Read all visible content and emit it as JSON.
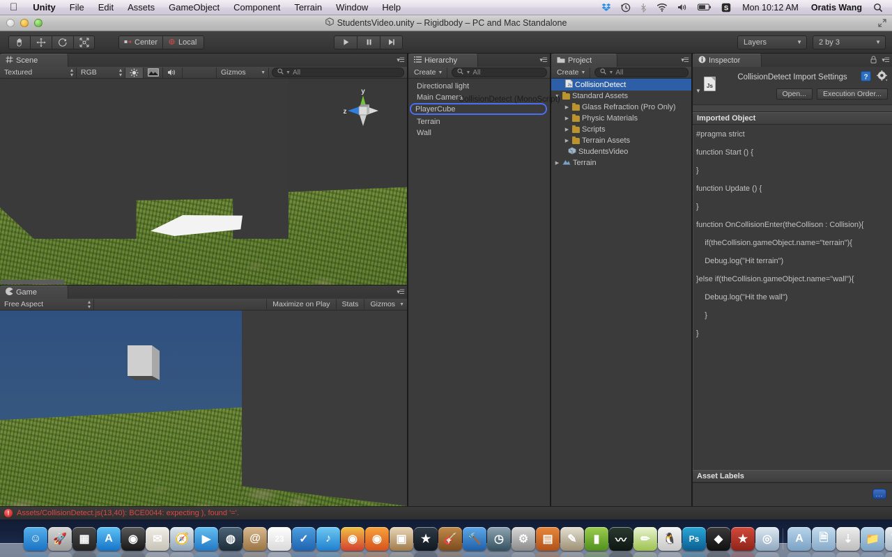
{
  "macbar": {
    "apple": "apple-logo",
    "menus": [
      "Unity",
      "File",
      "Edit",
      "Assets",
      "GameObject",
      "Component",
      "Terrain",
      "Window",
      "Help"
    ],
    "status_icons": [
      "dropbox-icon",
      "timemachine-icon",
      "bluetooth-icon",
      "wifi-icon",
      "volume-icon",
      "battery-icon",
      "snagit-icon"
    ],
    "clock": "Mon 10:12 AM",
    "user": "Oratis Wang",
    "search": "search-icon"
  },
  "window": {
    "title": "StudentsVideo.unity – Rigidbody – PC and Mac Standalone"
  },
  "toolbar": {
    "tools": [
      "hand-tool",
      "move-tool",
      "rotate-tool",
      "scale-tool"
    ],
    "pivot_mode": "Center",
    "pivot_rotation": "Local",
    "play": "play-button",
    "pause": "pause-button",
    "step": "step-button",
    "layers": "Layers",
    "layout": "2 by 3"
  },
  "scene": {
    "tab": "Scene",
    "draw_mode": "Textured",
    "render_mode": "RGB",
    "toggles": [
      "lighting-toggle",
      "fx-toggle",
      "audio-toggle"
    ],
    "gizmos": "Gizmos",
    "search_placeholder": "All",
    "gizmo_axes": {
      "y": "y",
      "z": "z"
    }
  },
  "game": {
    "tab": "Game",
    "aspect": "Free Aspect",
    "maximize": "Maximize on Play",
    "stats": "Stats",
    "gizmos": "Gizmos"
  },
  "hierarchy": {
    "tab": "Hierarchy",
    "create": "Create",
    "search_placeholder": "All",
    "items": [
      {
        "label": "Directional light",
        "state": "normal"
      },
      {
        "label": "Main Camera",
        "state": "normal"
      },
      {
        "label": "PlayerCube",
        "state": "drop-target"
      },
      {
        "label": "Terrain",
        "state": "normal"
      },
      {
        "label": "Wall",
        "state": "normal"
      }
    ],
    "drag_ghost": "CollisionDetect (MonoScript)"
  },
  "project": {
    "tab": "Project",
    "create": "Create",
    "search_placeholder": "All",
    "items": [
      {
        "label": "CollisionDetect",
        "icon": "js-script-icon",
        "indent": 0,
        "arrow": "",
        "selected": true
      },
      {
        "label": "Standard Assets",
        "icon": "folder-icon",
        "indent": 0,
        "arrow": "down",
        "selected": false
      },
      {
        "label": "Glass Refraction (Pro Only)",
        "icon": "folder-icon",
        "indent": 1,
        "arrow": "right",
        "selected": false
      },
      {
        "label": "Physic Materials",
        "icon": "folder-icon",
        "indent": 1,
        "arrow": "right",
        "selected": false
      },
      {
        "label": "Scripts",
        "icon": "folder-icon",
        "indent": 1,
        "arrow": "right",
        "selected": false
      },
      {
        "label": "Terrain Assets",
        "icon": "folder-icon",
        "indent": 1,
        "arrow": "right",
        "selected": false
      },
      {
        "label": "StudentsVideo",
        "icon": "unity-scene-icon",
        "indent": 0,
        "arrow": "",
        "selected": false
      },
      {
        "label": "Terrain",
        "icon": "terrain-icon",
        "indent": 0,
        "arrow": "right",
        "selected": false
      }
    ]
  },
  "inspector": {
    "tab": "Inspector",
    "title": "CollisionDetect Import Settings",
    "icon": "js-script-icon",
    "help": "help-icon",
    "settings": "gear-icon",
    "lock": "lock-icon",
    "open_button": "Open...",
    "execution_order_button": "Execution Order...",
    "imported_object_header": "Imported Object",
    "code": [
      "#pragma strict",
      "function Start () {",
      "}",
      "function Update () {",
      "}",
      "function OnCollisionEnter(theCollison : Collision){",
      "    if(theCollision.gameObject.name=\"terrain\"){",
      "    Debug.log(\"Hit terrain\")",
      "}else if(theCollision.gameObject.name=\"wall\"){",
      "    Debug.log(\"Hit the wall\")",
      "    }",
      "}"
    ],
    "asset_labels_header": "Asset Labels",
    "asset_labels_button": "..."
  },
  "statusbar": {
    "message": "Assets/CollisionDetect.js(13,40): BCE0044: expecting ), found '='.",
    "icon": "error-icon"
  },
  "dock": {
    "items": [
      {
        "name": "finder-icon",
        "color1": "#55b0ea",
        "color2": "#1b72c4",
        "glyph": "☺"
      },
      {
        "name": "launchpad-icon",
        "color1": "#d8d8d8",
        "color2": "#9a9a9a",
        "glyph": "🚀"
      },
      {
        "name": "mission-control-icon",
        "color1": "#4a4a4a",
        "color2": "#222",
        "glyph": "▦"
      },
      {
        "name": "app-store-icon",
        "color1": "#5fc3f5",
        "color2": "#1573c8",
        "glyph": "A"
      },
      {
        "name": "dashboard-icon",
        "color1": "#5a5a5a",
        "color2": "#161616",
        "glyph": "◉"
      },
      {
        "name": "mail-icon",
        "color1": "#f0efe8",
        "color2": "#c6c2b5",
        "glyph": "✉"
      },
      {
        "name": "safari-icon",
        "color1": "#dfe7ee",
        "color2": "#8fa4b8",
        "glyph": "🧭"
      },
      {
        "name": "facetime-icon",
        "color1": "#63bff0",
        "color2": "#2478c5",
        "glyph": "▶"
      },
      {
        "name": "photobooth-icon",
        "color1": "#4c6478",
        "color2": "#1d2c38",
        "glyph": "◍"
      },
      {
        "name": "contacts-icon",
        "color1": "#d8b98e",
        "color2": "#9a7444",
        "glyph": "@"
      },
      {
        "name": "calendar-icon",
        "color1": "#ffffff",
        "color2": "#d9d9d9",
        "glyph": "23"
      },
      {
        "name": "reminders-icon",
        "color1": "#4e9fe0",
        "color2": "#1e63b0",
        "glyph": "✓"
      },
      {
        "name": "itunes-icon",
        "color1": "#6ec9f2",
        "color2": "#1f7fce",
        "glyph": "♪"
      },
      {
        "name": "chrome-icon",
        "color1": "#f2c043",
        "color2": "#d2402f",
        "glyph": "◉"
      },
      {
        "name": "firefox-icon",
        "color1": "#f9a23c",
        "color2": "#d4521e",
        "glyph": "◉"
      },
      {
        "name": "preview-icon",
        "color1": "#e8d7b8",
        "color2": "#a07a4a",
        "glyph": "▣"
      },
      {
        "name": "imovie-icon",
        "color1": "#2f3b48",
        "color2": "#111820",
        "glyph": "★"
      },
      {
        "name": "garageband-icon",
        "color1": "#c08a4a",
        "color2": "#7b4b1d",
        "glyph": "🎸"
      },
      {
        "name": "xcode-icon",
        "color1": "#5fa8e8",
        "color2": "#1d5fa8",
        "glyph": "🔨"
      },
      {
        "name": "timemachine-icon",
        "color1": "#8fa4b2",
        "color2": "#33505f",
        "glyph": "◷"
      },
      {
        "name": "system-preferences-icon",
        "color1": "#d8d8d8",
        "color2": "#8a8a8a",
        "glyph": "⚙"
      },
      {
        "name": "keynote-icon",
        "color1": "#e8873a",
        "color2": "#b0521a",
        "glyph": "▤"
      },
      {
        "name": "pages-icon",
        "color1": "#e4e0d2",
        "color2": "#9c8f74",
        "glyph": "✎"
      },
      {
        "name": "numbers-icon",
        "color1": "#9dce4e",
        "color2": "#4f8f1e",
        "glyph": "▮"
      },
      {
        "name": "activity-monitor-icon",
        "color1": "#2a3a30",
        "color2": "#0e1612",
        "glyph": "〰"
      },
      {
        "name": "notes-icon",
        "color1": "#e9f4d2",
        "color2": "#9cc24e",
        "glyph": "✏"
      },
      {
        "name": "qq-icon",
        "color1": "#f5f5f5",
        "color2": "#c8c8c8",
        "glyph": "🐧"
      },
      {
        "name": "photoshop-icon",
        "color1": "#2aa8d8",
        "color2": "#0b5d90",
        "glyph": "Ps"
      },
      {
        "name": "unity-icon",
        "color1": "#3a3a3a",
        "color2": "#101010",
        "glyph": "◆"
      },
      {
        "name": "dictionary-icon",
        "color1": "#d24a3c",
        "color2": "#8e231a",
        "glyph": "★"
      },
      {
        "name": "wechat-icon",
        "color1": "#dfe9f2",
        "color2": "#8fa8c0",
        "glyph": "◎"
      }
    ],
    "stacks": [
      {
        "name": "applications-stack-icon",
        "color1": "#b8d4ea",
        "color2": "#7aa2c4",
        "glyph": "A"
      },
      {
        "name": "documents-stack-icon",
        "color1": "#c3dbee",
        "color2": "#86a9c8",
        "glyph": "🗎"
      },
      {
        "name": "downloads-stack-icon",
        "color1": "#eeeeee",
        "color2": "#bdbdbd",
        "glyph": "⇣"
      },
      {
        "name": "folder-stack-icon",
        "color1": "#b8d4ea",
        "color2": "#7aa2c4",
        "glyph": "📁"
      },
      {
        "name": "trash-icon",
        "color1": "#e8eef3",
        "color2": "#a8b8c4",
        "glyph": "🗑"
      }
    ]
  }
}
